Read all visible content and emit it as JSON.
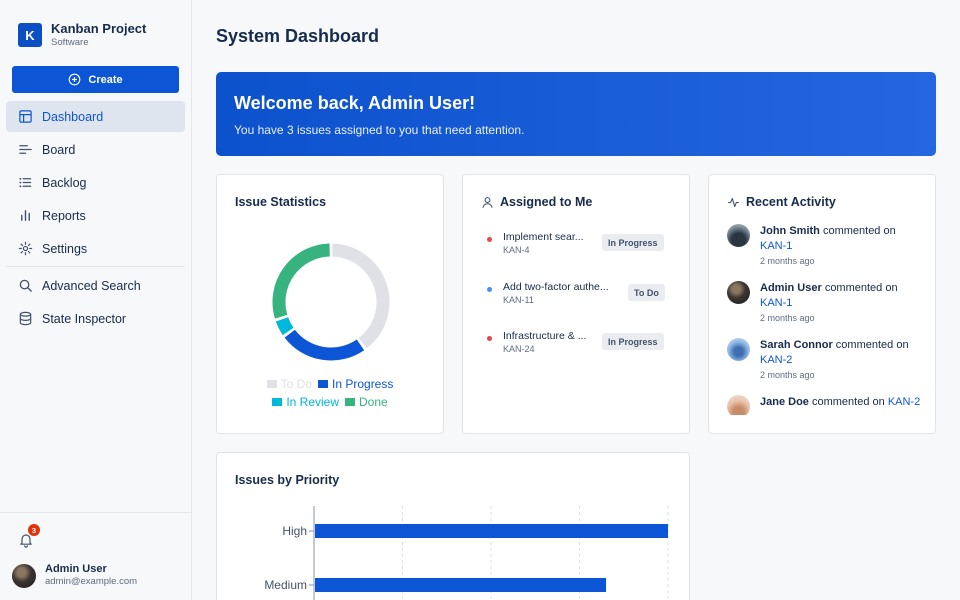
{
  "project": {
    "initial": "K",
    "name": "Kanban Project",
    "type": "Software"
  },
  "create_label": "Create",
  "nav": [
    {
      "label": "Dashboard",
      "icon": "dashboard-icon",
      "active": true
    },
    {
      "label": "Board",
      "icon": "board-icon"
    },
    {
      "label": "Backlog",
      "icon": "backlog-icon"
    },
    {
      "label": "Reports",
      "icon": "reports-icon"
    },
    {
      "label": "Settings",
      "icon": "settings-icon"
    },
    {
      "label": "Advanced Search",
      "icon": "search-icon"
    },
    {
      "label": "State Inspector",
      "icon": "database-icon"
    }
  ],
  "notifications": {
    "count": "3"
  },
  "user": {
    "name": "Admin User",
    "email": "admin@example.com"
  },
  "page_title": "System Dashboard",
  "welcome": {
    "title": "Welcome back, Admin User!",
    "message": "You have 3 issues assigned to you that need attention."
  },
  "stats": {
    "title": "Issue Statistics",
    "chart_data": {
      "type": "pie",
      "labels": [
        "To Do",
        "In Progress",
        "In Review",
        "Done"
      ],
      "values": [
        40,
        25,
        5,
        30
      ],
      "colors": [
        "#dfe1e6",
        "#0c56d6",
        "#00b8d9",
        "#36b37e"
      ],
      "legend": "bottom"
    }
  },
  "assigned": {
    "title": "Assigned to Me",
    "items": [
      {
        "title": "Implement sear...",
        "key": "KAN-4",
        "status": "In Progress",
        "dot": "#e5484d"
      },
      {
        "title": "Add two-factor authe...",
        "key": "KAN-11",
        "status": "To Do",
        "dot": "#4c8df6"
      },
      {
        "title": "Infrastructure & ...",
        "key": "KAN-24",
        "status": "In Progress",
        "dot": "#e5484d"
      }
    ]
  },
  "activity": {
    "title": "Recent Activity",
    "items": [
      {
        "name": "John Smith",
        "verb": "commented on",
        "key": "KAN-1",
        "time": "2 months ago"
      },
      {
        "name": "Admin User",
        "verb": "commented on",
        "key": "KAN-1",
        "time": "2 months ago"
      },
      {
        "name": "Sarah Connor",
        "verb": "commented on",
        "key": "KAN-2",
        "time": "2 months ago"
      },
      {
        "name": "Jane Doe",
        "verb": "commented on",
        "key": "KAN-2",
        "time": ""
      }
    ]
  },
  "priority": {
    "title": "Issues by Priority",
    "chart_data": {
      "type": "bar",
      "orientation": "horizontal",
      "categories": [
        "High",
        "Medium"
      ],
      "values": [
        4,
        3.3
      ],
      "xlim": [
        0,
        4
      ],
      "grid": true,
      "color": "#0c56d6"
    }
  }
}
